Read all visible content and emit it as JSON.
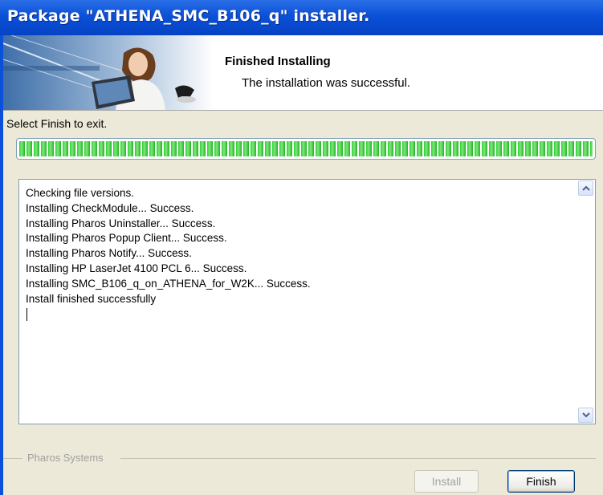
{
  "window": {
    "title": "Package \"ATHENA_SMC_B106_q\" installer."
  },
  "header": {
    "title": "Finished Installing",
    "subtitle": "The installation was successful."
  },
  "prompt": "Select Finish to exit.",
  "progress": {
    "percent": 100,
    "color": "#2ecf2e"
  },
  "log": {
    "lines": [
      "Checking file versions.",
      "Installing CheckModule... Success.",
      "Installing Pharos Uninstaller... Success.",
      "Installing Pharos Popup Client... Success.",
      "Installing Pharos Notify... Success.",
      "Installing HP LaserJet 4100 PCL 6... Success.",
      "Installing SMC_B106_q_on_ATHENA_for_W2K... Success.",
      "Install finished successfully"
    ]
  },
  "footer": {
    "group_label": "Pharos Systems"
  },
  "buttons": {
    "install": "Install",
    "finish": "Finish"
  },
  "colors": {
    "titlebar": "#0a50d8",
    "background": "#ece9d8",
    "progress": "#2ecf2e"
  }
}
